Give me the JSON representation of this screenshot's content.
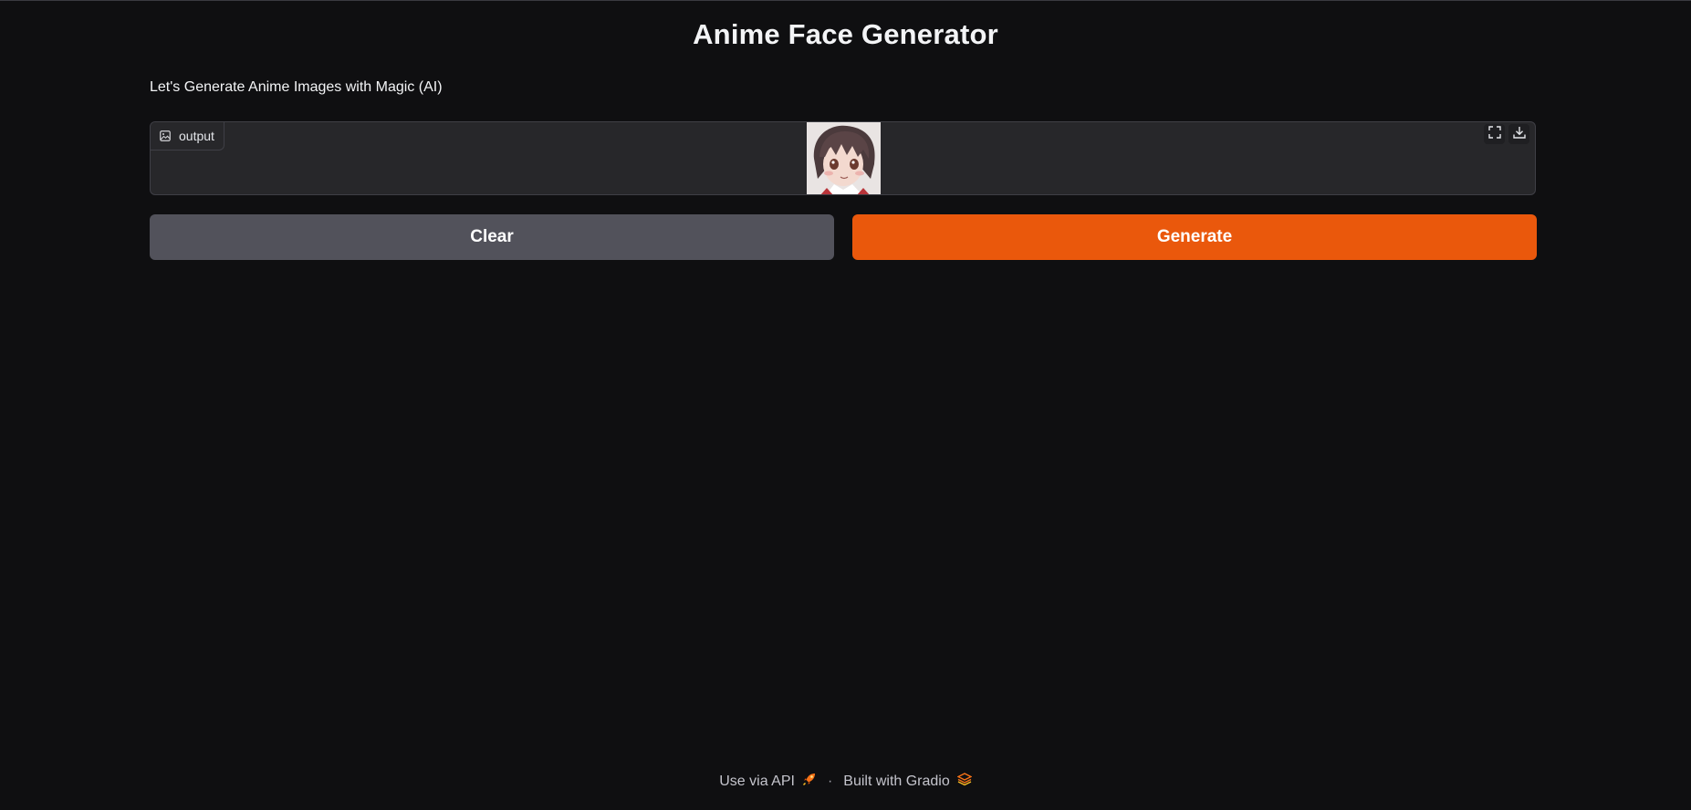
{
  "page": {
    "title": "Anime Face Generator",
    "description": "Let's Generate Anime Images with Magic (AI)"
  },
  "output_panel": {
    "label": "output",
    "label_icon": "image-icon",
    "actions": [
      {
        "name": "fullscreen",
        "icon": "fullscreen-icon"
      },
      {
        "name": "download",
        "icon": "download-icon"
      }
    ]
  },
  "buttons": {
    "clear_label": "Clear",
    "generate_label": "Generate"
  },
  "footer": {
    "api_label": "Use via API",
    "api_icon": "rocket-icon",
    "separator": "·",
    "built_label": "Built with Gradio",
    "built_icon": "gradio-logo-icon"
  },
  "colors": {
    "background": "#0f0f11",
    "panel": "#27272a",
    "clear_button": "#52525b",
    "generate_button": "#ea580c",
    "accent": "#f97316"
  }
}
